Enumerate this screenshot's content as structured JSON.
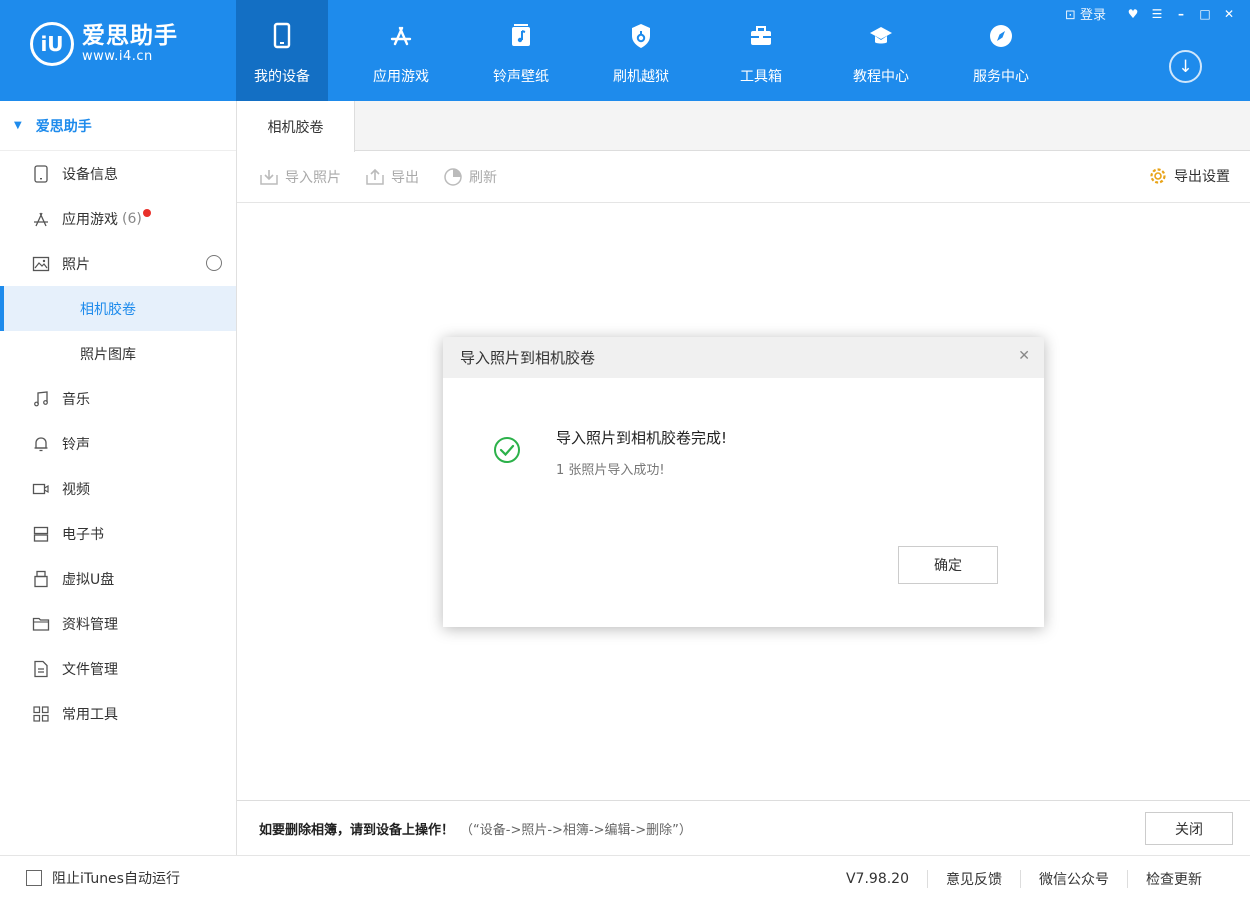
{
  "app": {
    "logo_mark": "iU",
    "logo_title": "爱思助手",
    "logo_url": "www.i4.cn",
    "brand_color": "#1e8bec"
  },
  "nav": [
    {
      "label": "我的设备",
      "icon": "phone-icon"
    },
    {
      "label": "应用游戏",
      "icon": "app-store-icon"
    },
    {
      "label": "铃声壁纸",
      "icon": "music-note-icon"
    },
    {
      "label": "刷机越狱",
      "icon": "shield-icon"
    },
    {
      "label": "工具箱",
      "icon": "toolbox-icon"
    },
    {
      "label": "教程中心",
      "icon": "graduation-cap-icon"
    },
    {
      "label": "服务中心",
      "icon": "compass-icon"
    }
  ],
  "window": {
    "login": "登录"
  },
  "sidebar": {
    "header": "爱思助手",
    "items": [
      {
        "label": "设备信息",
        "icon": "device-icon"
      },
      {
        "label": "应用游戏",
        "count": "(6)",
        "icon": "app-store-icon"
      },
      {
        "label": "照片",
        "icon": "image-icon"
      },
      {
        "label": "相机胶卷",
        "sub": true
      },
      {
        "label": "照片图库",
        "sub": true
      },
      {
        "label": "音乐",
        "icon": "music-icon"
      },
      {
        "label": "铃声",
        "icon": "bell-icon"
      },
      {
        "label": "视频",
        "icon": "video-icon"
      },
      {
        "label": "电子书",
        "icon": "ebook-icon"
      },
      {
        "label": "虚拟U盘",
        "icon": "usb-drive-icon"
      },
      {
        "label": "资料管理",
        "icon": "folder-icon"
      },
      {
        "label": "文件管理",
        "icon": "file-icon"
      },
      {
        "label": "常用工具",
        "icon": "grid-icon"
      }
    ]
  },
  "main": {
    "tab": "相机胶卷",
    "toolbar": {
      "import": "导入照片",
      "export": "导出",
      "refresh": "刷新",
      "export_settings": "导出设置"
    },
    "footer": {
      "warning": "如要删除相簿，请到设备上操作！",
      "hint": "（“设备->照片->相簿->编辑->删除”）",
      "close": "关闭"
    }
  },
  "dialog": {
    "title": "导入照片到相机胶卷",
    "message": "导入照片到相机胶卷完成!",
    "detail": "1 张照片导入成功!",
    "ok": "确定",
    "success_color": "#2cb14a"
  },
  "statusbar": {
    "checkbox_label": "阻止iTunes自动运行",
    "version": "V7.98.20",
    "feedback": "意见反馈",
    "wechat": "微信公众号",
    "update": "检查更新"
  }
}
